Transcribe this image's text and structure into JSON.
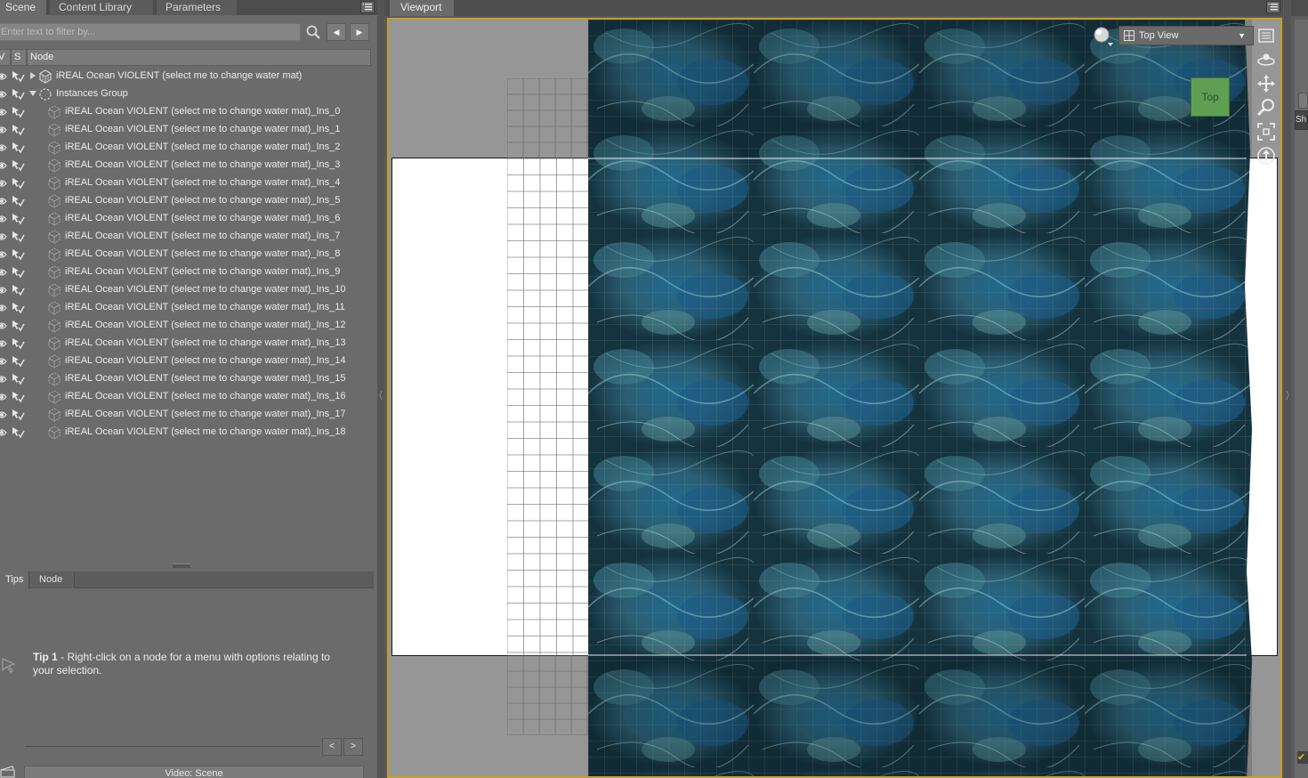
{
  "left_tabs": [
    {
      "label": "Scene",
      "active": true
    },
    {
      "label": "Content Library",
      "active": false
    },
    {
      "label": "Parameters",
      "active": false
    }
  ],
  "filter": {
    "placeholder": "Enter text to filter by..."
  },
  "nav_buttons": {
    "back": "◀",
    "forward": "▶"
  },
  "columns": [
    {
      "label": "V"
    },
    {
      "label": "S"
    },
    {
      "label": "Node"
    }
  ],
  "tree": [
    {
      "label": "iREAL Ocean VIOLENT (select me to change water mat)",
      "icon": "figure-icon",
      "expander": "collapsed",
      "depth": 0
    },
    {
      "label": "Instances Group",
      "icon": "group-icon",
      "expander": "expanded",
      "depth": 0
    },
    {
      "label": "iREAL Ocean VIOLENT (select me to change water mat)_Ins_0",
      "icon": "instance-icon",
      "depth": 1
    },
    {
      "label": "iREAL Ocean VIOLENT (select me to change water mat)_Ins_1",
      "icon": "instance-icon",
      "depth": 1
    },
    {
      "label": "iREAL Ocean VIOLENT (select me to change water mat)_Ins_2",
      "icon": "instance-icon",
      "depth": 1
    },
    {
      "label": "iREAL Ocean VIOLENT (select me to change water mat)_Ins_3",
      "icon": "instance-icon",
      "depth": 1
    },
    {
      "label": "iREAL Ocean VIOLENT (select me to change water mat)_Ins_4",
      "icon": "instance-icon",
      "depth": 1
    },
    {
      "label": "iREAL Ocean VIOLENT (select me to change water mat)_Ins_5",
      "icon": "instance-icon",
      "depth": 1
    },
    {
      "label": "iREAL Ocean VIOLENT (select me to change water mat)_Ins_6",
      "icon": "instance-icon",
      "depth": 1
    },
    {
      "label": "iREAL Ocean VIOLENT (select me to change water mat)_Ins_7",
      "icon": "instance-icon",
      "depth": 1
    },
    {
      "label": "iREAL Ocean VIOLENT (select me to change water mat)_Ins_8",
      "icon": "instance-icon",
      "depth": 1
    },
    {
      "label": "iREAL Ocean VIOLENT (select me to change water mat)_Ins_9",
      "icon": "instance-icon",
      "depth": 1
    },
    {
      "label": "iREAL Ocean VIOLENT (select me to change water mat)_Ins_10",
      "icon": "instance-icon",
      "depth": 1
    },
    {
      "label": "iREAL Ocean VIOLENT (select me to change water mat)_Ins_11",
      "icon": "instance-icon",
      "depth": 1
    },
    {
      "label": "iREAL Ocean VIOLENT (select me to change water mat)_Ins_12",
      "icon": "instance-icon",
      "depth": 1
    },
    {
      "label": "iREAL Ocean VIOLENT (select me to change water mat)_Ins_13",
      "icon": "instance-icon",
      "depth": 1
    },
    {
      "label": "iREAL Ocean VIOLENT (select me to change water mat)_Ins_14",
      "icon": "instance-icon",
      "depth": 1
    },
    {
      "label": "iREAL Ocean VIOLENT (select me to change water mat)_Ins_15",
      "icon": "instance-icon",
      "depth": 1
    },
    {
      "label": "iREAL Ocean VIOLENT (select me to change water mat)_Ins_16",
      "icon": "instance-icon",
      "depth": 1
    },
    {
      "label": "iREAL Ocean VIOLENT (select me to change water mat)_Ins_17",
      "icon": "instance-icon",
      "depth": 1
    },
    {
      "label": "iREAL Ocean VIOLENT (select me to change water mat)_Ins_18",
      "icon": "instance-icon",
      "depth": 1
    }
  ],
  "lower_tabs": [
    {
      "label": "Tips",
      "active": true
    },
    {
      "label": "Node",
      "active": false
    }
  ],
  "tip": {
    "title": "Tip 1",
    "text": " - Right-click on a node for a menu with options relating to your selection."
  },
  "pager": {
    "prev": "<",
    "next": ">"
  },
  "video_bar": {
    "label": "Video: Scene"
  },
  "viewport": {
    "tab_label": "Viewport",
    "view_mode": "Top View",
    "nav_cube_label": "Top"
  },
  "right_strip": {
    "button_text": "Sh",
    "check": "✔"
  },
  "colors": {
    "panel_bg": "#6b6b6b",
    "tab_bar": "#4d4d4d",
    "viewport_border": "#c9a022",
    "nav_cube": "#5e9f54",
    "ocean_dark": "#1b4a5c",
    "ocean_light": "#3d8ea8"
  }
}
